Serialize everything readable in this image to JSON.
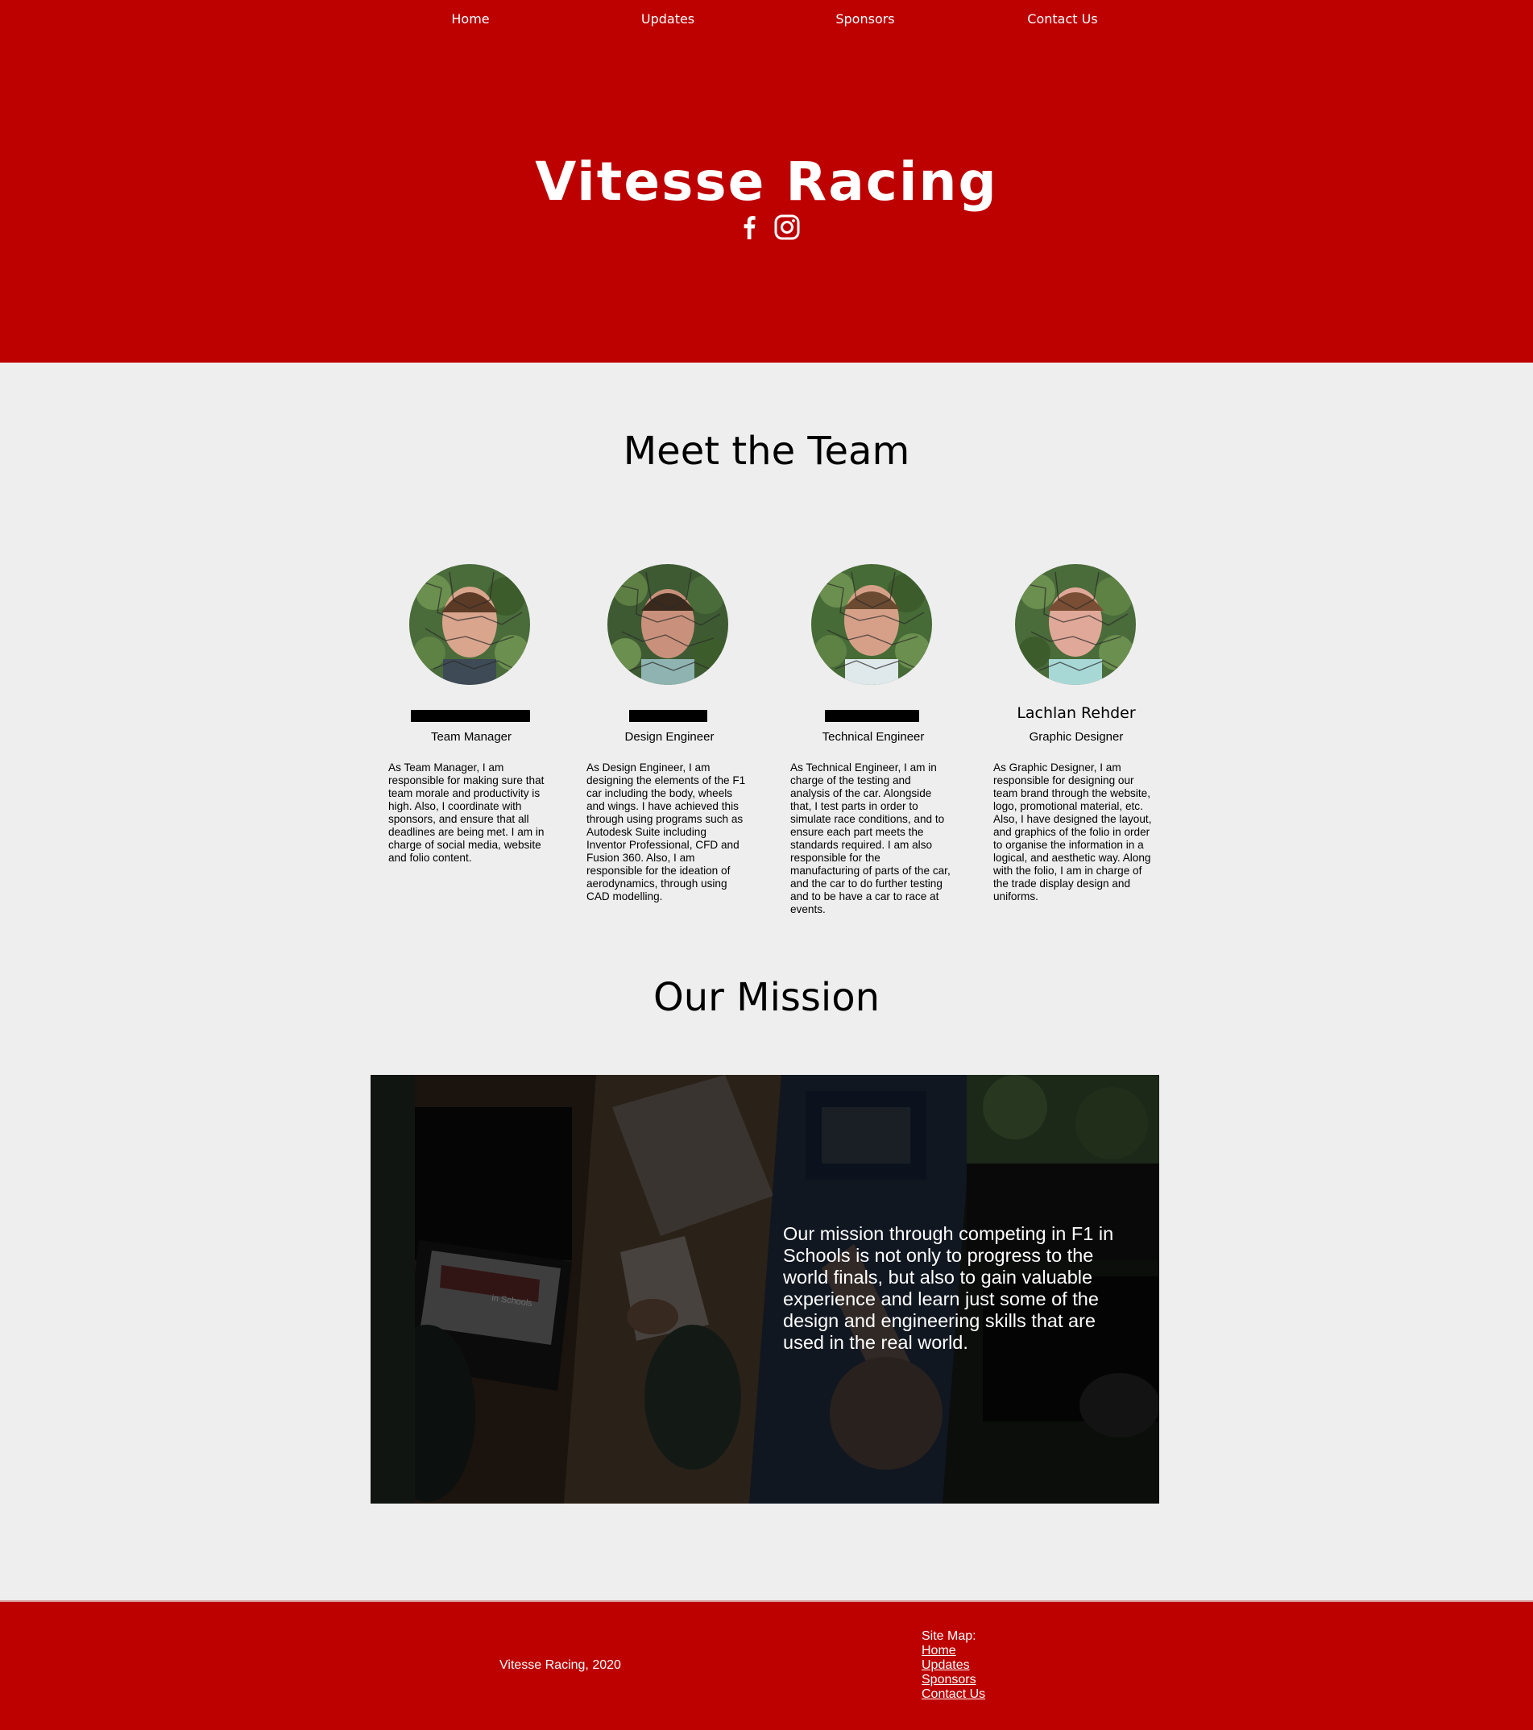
{
  "nav": {
    "items": [
      {
        "label": "Home"
      },
      {
        "label": "Updates"
      },
      {
        "label": "Sponsors"
      },
      {
        "label": "Contact Us"
      }
    ]
  },
  "header": {
    "title": "Vitesse Racing",
    "social": [
      "facebook-icon",
      "instagram-icon"
    ],
    "background": "#bd0000"
  },
  "team": {
    "title": "Meet the Team",
    "members": [
      {
        "name": "",
        "role": "Team Manager",
        "bio": "As Team Manager, I am responsible for making sure that team morale and productivity is high. Also, I coordinate with sponsors, and ensure that all deadlines are being met. I am in charge of social media, website and folio content."
      },
      {
        "name": "",
        "role": "Design Engineer",
        "bio": "As Design Engineer, I am designing the elements of the F1 car including the body, wheels and wings. I have achieved this through using programs such as Autodesk Suite including Inventor Professional, CFD and Fusion 360. Also, I am responsible for the ideation of aerodynamics, through using CAD modelling."
      },
      {
        "name": "",
        "role": "Technical Engineer",
        "bio": "As Technical Engineer, I am in charge of the testing and analysis of the car. Alongside that, I test parts in order to simulate race conditions, and to ensure each part meets the standards required. I am also responsible for the manufacturing of parts of the car, and the car to do further testing and to be have a car to race at events."
      },
      {
        "name": "Lachlan Rehder",
        "role": "Graphic Designer",
        "bio": "As Graphic Designer, I am responsible for designing our team brand through the website, logo, promotional material, etc. Also, I have designed the layout, and graphics of the folio in order to organise the information in a logical, and aesthetic way. Along with the folio, I am in charge of the trade display design and uniforms."
      }
    ]
  },
  "mission": {
    "title": "Our Mission",
    "text": "Our mission through competing in F1 in Schools is not only to progress to the world finals, but also to gain valuable experience and learn just some of the design and engineering skills that are used in the real world."
  },
  "footer": {
    "copyright": "Vitesse Racing, 2020",
    "sitemap_label": "Site Map:",
    "links": [
      "Home",
      "Updates",
      "Sponsors",
      "Contact Us"
    ]
  }
}
